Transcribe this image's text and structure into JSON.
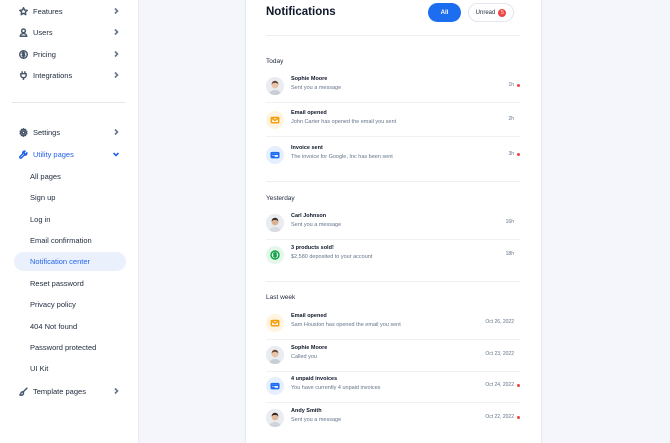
{
  "sidebar": {
    "items": [
      {
        "label": "Features",
        "icon": "star-icon"
      },
      {
        "label": "Users",
        "icon": "user-icon"
      },
      {
        "label": "Pricing",
        "icon": "dollar-icon"
      },
      {
        "label": "Integrations",
        "icon": "plug-icon"
      },
      {
        "label": "Settings",
        "icon": "gear-icon"
      },
      {
        "label": "Utility pages",
        "icon": "wrench-icon"
      }
    ],
    "sub_items": [
      "All pages",
      "Sign up",
      "Log in",
      "Email confirmation",
      "Notification center",
      "Reset password",
      "Privacy policy",
      "404 Not found",
      "Password protected",
      "UI Kit"
    ],
    "active_sub": "Notification center",
    "template": {
      "label": "Template pages",
      "icon": "brush-icon"
    }
  },
  "main": {
    "title": "Notifications",
    "filters": {
      "all": "All",
      "unread": "Unread",
      "unread_count": "5"
    },
    "accent": "#1d6df0",
    "groups": [
      {
        "title": "Today",
        "items": [
          {
            "title": "Sophie Moore",
            "body": "Sent you a message",
            "time": "1h",
            "unread": true,
            "kind": "avatar"
          },
          {
            "title": "Email opened",
            "body": "John Carter has opened the email you sent",
            "time": "2h",
            "unread": false,
            "kind": "mail"
          },
          {
            "title": "Invoice sent",
            "body": "The invoice for Google, Inc has been sent",
            "time": "3h",
            "unread": true,
            "kind": "card"
          }
        ]
      },
      {
        "title": "Yesterday",
        "items": [
          {
            "title": "Carl Johnson",
            "body": "Sent you a message",
            "time": "16h",
            "unread": false,
            "kind": "avatar"
          },
          {
            "title": "3 products sold!",
            "body": "$2,580 deposited to your account",
            "time": "18h",
            "unread": false,
            "kind": "dollar"
          }
        ]
      },
      {
        "title": "Last week",
        "items": [
          {
            "title": "Email opened",
            "body": "Sam Houston has opened the email you sent",
            "time": "Oct 26, 2022",
            "unread": false,
            "kind": "mail"
          },
          {
            "title": "Sophie Moore",
            "body": "Called you",
            "time": "Oct 23, 2022",
            "unread": false,
            "kind": "avatar"
          },
          {
            "title": "4 unpaid invoices",
            "body": "You have currently 4 unpaid invoices",
            "time": "Oct 24, 2022",
            "unread": true,
            "kind": "card"
          },
          {
            "title": "Andy Smith",
            "body": "Sent you a message",
            "time": "Oct 22, 2022",
            "unread": true,
            "kind": "avatar"
          }
        ]
      }
    ]
  }
}
